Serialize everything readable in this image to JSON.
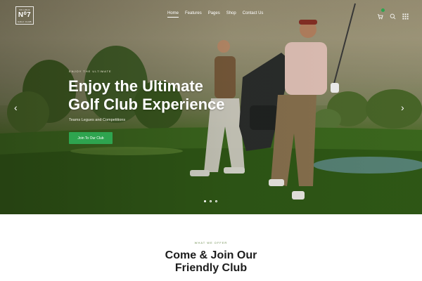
{
  "header": {
    "logo": {
      "top_text": "NO.HOLE",
      "main_text": "N⁰7",
      "bottom_text": "GOLF CLUB"
    },
    "nav": [
      "Home",
      "Features",
      "Pages",
      "Shop",
      "Contact Us"
    ],
    "active_nav": "Home",
    "icons": [
      "cart-icon",
      "search-icon",
      "grid-menu-icon"
    ],
    "accent": "#2ea44f"
  },
  "hero": {
    "eyebrow": "ENJOY THE ULTIMATE",
    "title_line1": "Enjoy the Ultimate",
    "title_line2": "Golf Club Experience",
    "subtitle": "Teams Legues and Competitions",
    "cta_label": "Join To Our Club",
    "prev_arrow": "‹",
    "next_arrow": "›",
    "slides": 3,
    "active_slide": 1
  },
  "offer": {
    "eyebrow": "WHAT WE OFFER",
    "title_line1": "Come & Join Our",
    "title_line2": "Friendly Club"
  }
}
